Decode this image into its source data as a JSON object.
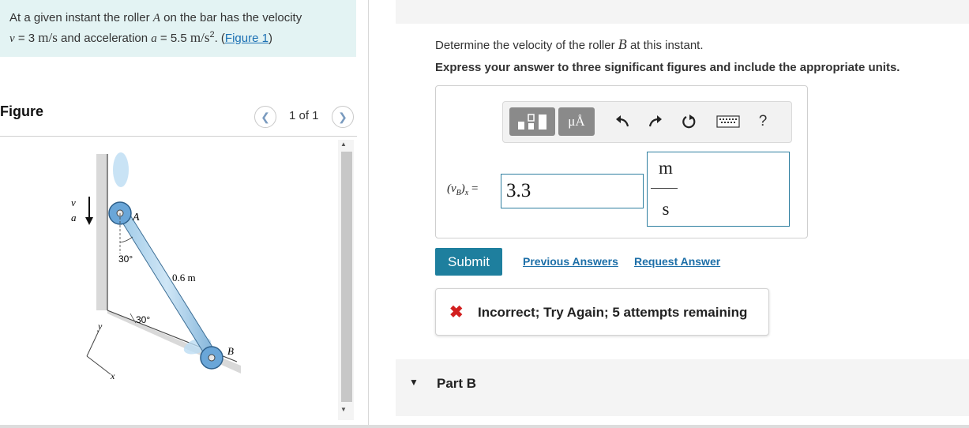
{
  "problem": {
    "text_before": "At a given instant the roller ",
    "roller_a": "A",
    "text_mid1": " on the bar has the velocity",
    "v_symbol": "v",
    "v_value": " = 3 ",
    "v_unit": "m/s",
    "text_mid2": " and acceleration ",
    "a_symbol": "a",
    "a_value": " = 5.5 ",
    "a_unit": "m/s",
    "a_unit_exp": "2",
    "text_mid3": ". (",
    "figure_link": "Figure 1",
    "text_end": ")"
  },
  "figure_panel": {
    "title": "Figure",
    "counter": "1 of 1",
    "prev_icon": "chevron-left-icon",
    "next_icon": "chevron-right-icon"
  },
  "diagram": {
    "v_label": "v",
    "a_label": "a",
    "point_a": "A",
    "point_b": "B",
    "angle_top": "30°",
    "angle_bottom": "30°",
    "length_label": "0.6 m",
    "axis_x": "x",
    "axis_y": "y"
  },
  "question": {
    "text_before": "Determine the velocity of the roller ",
    "roller_b": "B",
    "text_after": " at this instant.",
    "instruction": "Express your answer to three significant figures and include the appropriate units."
  },
  "toolbar": {
    "units_label": "μÅ",
    "help_label": "?",
    "icons": [
      "templates-icon",
      "units-icon",
      "undo-icon",
      "redo-icon",
      "reset-icon",
      "keyboard-icon",
      "help-icon"
    ]
  },
  "answer": {
    "var_label": "(v",
    "var_sub": "B",
    "var_close": ")",
    "var_sub2": "x",
    "equals": " = ",
    "value": "3.3",
    "unit_numerator": "m",
    "unit_denominator": "s"
  },
  "actions": {
    "submit": "Submit",
    "previous_answers": "Previous Answers",
    "request_answer": "Request Answer"
  },
  "feedback": {
    "icon": "✖",
    "message": "Incorrect; Try Again; 5 attempts remaining"
  },
  "part_b": {
    "caret": "▼",
    "title": "Part B"
  },
  "colors": {
    "problem_bg": "#e3f3f3",
    "submit_bg": "#1e7f9e",
    "link": "#1d6fa8",
    "error": "#d21f1f",
    "input_border": "#2f7fa0"
  }
}
